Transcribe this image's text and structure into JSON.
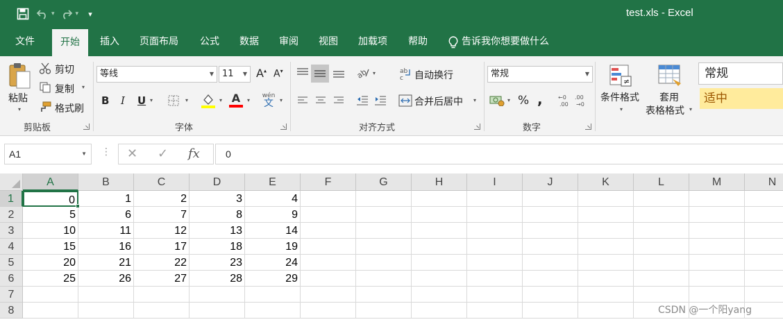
{
  "window": {
    "title": "test.xls  -  Excel",
    "qat_more": "▾"
  },
  "tabs": [
    {
      "label": "文件"
    },
    {
      "label": "开始",
      "active": true
    },
    {
      "label": "插入"
    },
    {
      "label": "页面布局"
    },
    {
      "label": "公式"
    },
    {
      "label": "数据"
    },
    {
      "label": "审阅"
    },
    {
      "label": "视图"
    },
    {
      "label": "加载项"
    },
    {
      "label": "帮助"
    }
  ],
  "tell_me": "告诉我你想要做什么",
  "ribbon": {
    "clipboard": {
      "paste": "粘贴",
      "cut": "剪切",
      "copy": "复制",
      "format_painter": "格式刷",
      "label": "剪贴板"
    },
    "font": {
      "name": "等线",
      "size": "11",
      "grow": "A",
      "shrink": "A",
      "bold": "B",
      "italic": "I",
      "underline": "U",
      "font_color": "A",
      "phonetic_top": "wén",
      "phonetic_bottom": "文",
      "label": "字体"
    },
    "alignment": {
      "wrap_text": "自动换行",
      "merge_center": "合并后居中",
      "label": "对齐方式"
    },
    "number": {
      "format": "常规",
      "percent": "%",
      "comma": ",",
      "label": "数字"
    },
    "styles": {
      "conditional": "条件格式",
      "table_line1": "套用",
      "table_line2": "表格格式",
      "normal": "常规",
      "neutral": "适中"
    }
  },
  "formula_bar": {
    "name_box": "A1",
    "cancel": "✕",
    "enter": "✓",
    "fx": "fx",
    "value": "0"
  },
  "sheet": {
    "columns": [
      "A",
      "B",
      "C",
      "D",
      "E",
      "F",
      "G",
      "H",
      "I",
      "J",
      "K",
      "L",
      "M",
      "N"
    ],
    "rows": [
      "1",
      "2",
      "3",
      "4",
      "5",
      "6",
      "7",
      "8"
    ],
    "cells": [
      [
        "0",
        "1",
        "2",
        "3",
        "4"
      ],
      [
        "5",
        "6",
        "7",
        "8",
        "9"
      ],
      [
        "10",
        "11",
        "12",
        "13",
        "14"
      ],
      [
        "15",
        "16",
        "17",
        "18",
        "19"
      ],
      [
        "20",
        "21",
        "22",
        "23",
        "24"
      ],
      [
        "25",
        "26",
        "27",
        "28",
        "29"
      ],
      [],
      []
    ],
    "selected": "A1"
  },
  "watermark": "CSDN @一个阳yang",
  "colors": {
    "excel_green": "#217346",
    "ribbon_bg": "#f3f3f3",
    "neutral_fill": "#ffeb9c",
    "neutral_text": "#9c5700"
  }
}
